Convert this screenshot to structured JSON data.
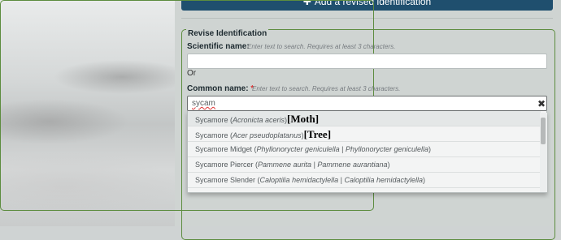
{
  "header": {
    "add_revision_label": "Add a revised identification"
  },
  "revise": {
    "legend": "Revise Identification",
    "scientific_label": "Scientific name:",
    "scientific_hint": "Enter text to search. Requires at least 3 characters.",
    "scientific_value": "",
    "or_text": "Or",
    "common_label": "Common name:",
    "required_mark": "*",
    "common_hint": "Enter text to search. Requires at least 3 characters.",
    "common_value": "sycam"
  },
  "results": [
    {
      "name": "Sycamore",
      "scientific": "Acronicta aceris",
      "extra": "",
      "tag": "[Moth]"
    },
    {
      "name": "Sycamore",
      "scientific": "Acer pseudoplatanus",
      "extra": "",
      "tag": "[Tree]"
    },
    {
      "name": "Sycamore Midget",
      "scientific": "Phyllonorycter geniculella",
      "extra": "Phyllonorycter geniculella",
      "tag": ""
    },
    {
      "name": "Sycamore Piercer",
      "scientific": "Pammene aurita",
      "extra": "Pammene aurantiana",
      "tag": ""
    },
    {
      "name": "Sycamore Slender",
      "scientific": "Caloptilia hemidactylella",
      "extra": "Caloptilia hemidactylella",
      "tag": ""
    }
  ],
  "colors": {
    "primary": "#1f4f6e",
    "fieldset_border": "#5c8c3e",
    "required": "#dd3333"
  },
  "icons": {
    "add": "plus-icon",
    "clear": "close-icon"
  }
}
